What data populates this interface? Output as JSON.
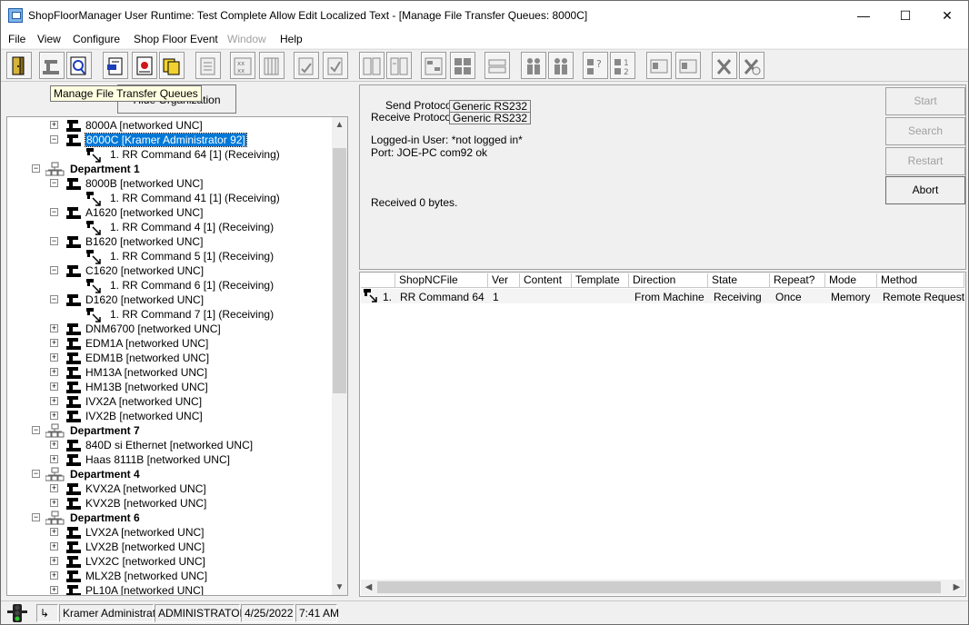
{
  "window": {
    "title": "ShopFloorManager User Runtime: Test Complete Allow Edit Localized Text - [Manage File Transfer Queues: 8000C]",
    "min_glyph": "—",
    "max_glyph": "☐",
    "close_glyph": "✕"
  },
  "menubar": {
    "items": [
      {
        "label": "File"
      },
      {
        "label": "View"
      },
      {
        "label": "Configure"
      },
      {
        "label": "Shop Floor Event"
      },
      {
        "label": "Window"
      },
      {
        "label": "Help"
      }
    ]
  },
  "tooltip": "Manage File Transfer Queues",
  "hide_org_button": "Hide Organization",
  "tree": {
    "rows": [
      {
        "label": "8000A [networked UNC]"
      },
      {
        "label": "8000C [Kramer Administrator 92]"
      },
      {
        "label": "1. RR Command 64 [1] (Receiving)"
      },
      {
        "label": "Department 1"
      },
      {
        "label": "8000B [networked UNC]"
      },
      {
        "label": "1. RR Command 41 [1] (Receiving)"
      },
      {
        "label": "A1620 [networked UNC]"
      },
      {
        "label": "1. RR Command 4 [1] (Receiving)"
      },
      {
        "label": "B1620 [networked UNC]"
      },
      {
        "label": "1. RR Command 5 [1] (Receiving)"
      },
      {
        "label": "C1620 [networked UNC]"
      },
      {
        "label": "1. RR Command 6 [1] (Receiving)"
      },
      {
        "label": "D1620 [networked UNC]"
      },
      {
        "label": "1. RR Command 7 [1] (Receiving)"
      },
      {
        "label": "DNM6700 [networked UNC]"
      },
      {
        "label": "EDM1A [networked UNC]"
      },
      {
        "label": "EDM1B [networked UNC]"
      },
      {
        "label": "HM13A [networked UNC]"
      },
      {
        "label": "HM13B [networked UNC]"
      },
      {
        "label": "IVX2A [networked UNC]"
      },
      {
        "label": "IVX2B [networked UNC]"
      },
      {
        "label": "Department 7"
      },
      {
        "label": "840D si Ethernet [networked UNC]"
      },
      {
        "label": "Haas 8111B [networked UNC]"
      },
      {
        "label": "Department 4"
      },
      {
        "label": "KVX2A [networked UNC]"
      },
      {
        "label": "KVX2B [networked UNC]"
      },
      {
        "label": "Department 6"
      },
      {
        "label": "LVX2A [networked UNC]"
      },
      {
        "label": "LVX2B [networked UNC]"
      },
      {
        "label": "LVX2C [networked UNC]"
      },
      {
        "label": "MLX2B [networked UNC]"
      },
      {
        "label": "PL10A [networked UNC]"
      }
    ]
  },
  "info": {
    "send_protocol_label": "Send Protocol:",
    "send_protocol_value": "Generic RS232",
    "receive_protocol_label": "Receive Protocol:",
    "receive_protocol_value": "Generic RS232",
    "logged_in": "Logged-in User: *not logged in*",
    "port": "Port: JOE-PC com92 ok",
    "received": "Received 0 bytes."
  },
  "side_buttons": {
    "start": "Start",
    "search": "Search",
    "restart": "Restart",
    "abort": "Abort"
  },
  "grid": {
    "columns": [
      "ShopNCFile",
      "Ver",
      "Content",
      "Template",
      "Direction",
      "State",
      "Repeat?",
      "Mode",
      "Method"
    ],
    "rows": [
      {
        "index": "1.",
        "shopncfile": "RR Command 64",
        "ver": "1",
        "content": "",
        "template": "",
        "direction": "From Machine",
        "state": "Receiving",
        "repeat": "Once",
        "mode": "Memory",
        "method": "Remote Request"
      }
    ]
  },
  "statusbar": {
    "user": "Kramer Administrator",
    "role": "ADMINISTRATOR",
    "date": "4/25/2022",
    "time": "7:41 AM"
  }
}
